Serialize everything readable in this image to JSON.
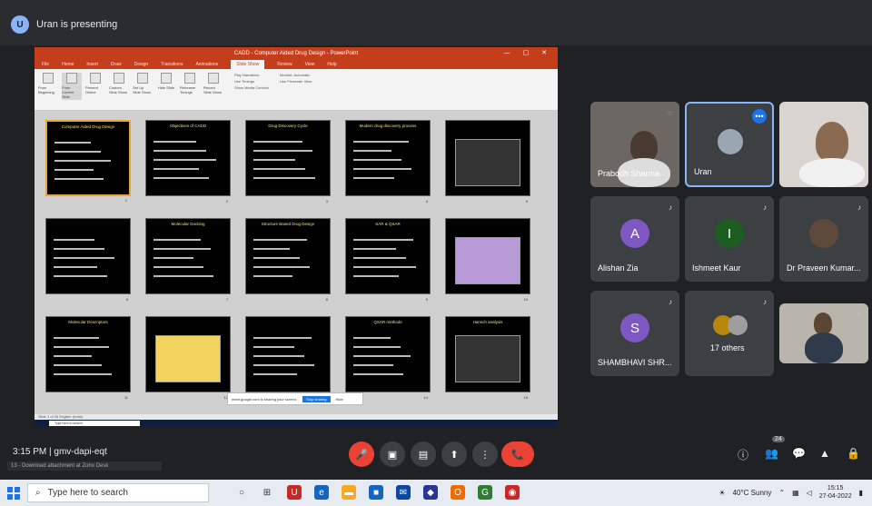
{
  "meet": {
    "presenting_text": "Uran is presenting",
    "presenter_initial": "U",
    "time_code": "3:15 PM  |  gmv-dapi-eqt",
    "download_text": "13 - Download attachment at Zoho Desk"
  },
  "ppt": {
    "title": "CADD - Computer Aided Drug Design - PowerPoint",
    "win_buttons": "— ▢ ✕",
    "tabs": [
      "File",
      "Home",
      "Insert",
      "Draw",
      "Design",
      "Transitions",
      "Animations",
      "Slide Show",
      "Review",
      "View",
      "Help"
    ],
    "active_tab": "Slide Show",
    "ribbon_buttons": [
      "From Beginning",
      "From Current Slide",
      "Present Online",
      "Custom Slide Show",
      "Set Up Slide Show",
      "Hide Slide",
      "Rehearse Timings",
      "Record Slide Show"
    ],
    "ribbon_checks": [
      "Play Narrations",
      "Use Timings",
      "Show Media Controls"
    ],
    "ribbon_monitor": "Monitor: Automatic",
    "ribbon_presenter": "Use Presenter View",
    "status_text": "Slide 1 of 26    English (India)",
    "notification": "meet.google.com is sharing your screen.",
    "stop_sharing": "Stop sharing",
    "hide": "Hide",
    "inner_search": "Type here to search",
    "slides": [
      {
        "title": "Computer Aided Drug Design",
        "n": "1"
      },
      {
        "title": "Objectives of CADD",
        "n": "2"
      },
      {
        "title": "Drug Discovery Cycle",
        "n": "3"
      },
      {
        "title": "Modern drug discovery process",
        "n": "4"
      },
      {
        "title": "",
        "n": "5"
      },
      {
        "title": "",
        "n": "6"
      },
      {
        "title": "Molecular Docking",
        "n": "7"
      },
      {
        "title": "Structure Based Drug Design",
        "n": "8"
      },
      {
        "title": "SAR & QSAR",
        "n": "9"
      },
      {
        "title": "",
        "n": "10"
      },
      {
        "title": "Molecular Descriptors",
        "n": "11"
      },
      {
        "title": "",
        "n": "12"
      },
      {
        "title": "",
        "n": "13"
      },
      {
        "title": "QSAR methods",
        "n": "14"
      },
      {
        "title": "Hansch analysis",
        "n": "15"
      }
    ]
  },
  "participants": [
    {
      "name": "Prabodh Sharma",
      "initial": ""
    },
    {
      "name": "Uran",
      "initial": ""
    },
    {
      "name": "",
      "initial": ""
    },
    {
      "name": "Alishan Zia",
      "initial": "A",
      "color": "#7e57c2"
    },
    {
      "name": "Ishmeet Kaur",
      "initial": "I",
      "color": "#1b5e20"
    },
    {
      "name": "Dr Praveen Kumar...",
      "initial": ""
    },
    {
      "name": "SHAMBHAVI SHR...",
      "initial": "S",
      "color": "#7e57c2"
    },
    {
      "name": "17 others",
      "initial": ""
    },
    {
      "name": "",
      "initial": ""
    }
  ],
  "controls": {
    "mic": "🎤",
    "camera": "▣",
    "captions": "▤",
    "present": "⬆",
    "more": "⋮",
    "end": "📞"
  },
  "right_icons": [
    "ⓘ",
    "👥",
    "💬",
    "▲",
    "🔒"
  ],
  "people_count": "24",
  "taskbar": {
    "search_placeholder": "Type here to search",
    "weather": "40°C Sunny",
    "time": "15:15",
    "date": "27-04-2022"
  },
  "colors": {
    "ppt_accent": "#c43e1c",
    "meet_bg": "#202124",
    "end_call": "#ea4335"
  }
}
